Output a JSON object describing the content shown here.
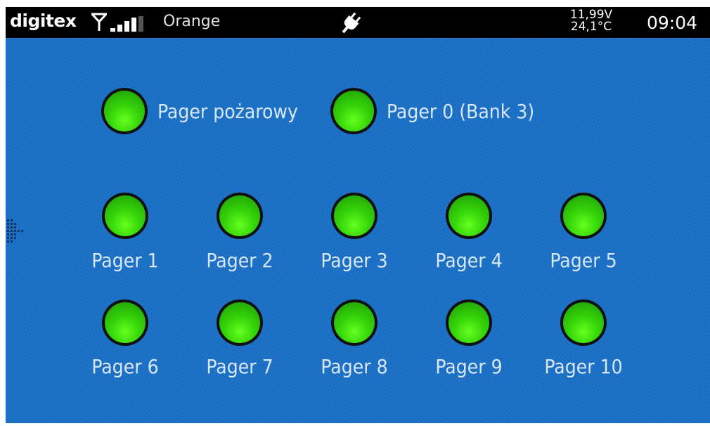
{
  "statusbar": {
    "brand": "digitex",
    "carrier": "Orange",
    "voltage": "11,99V",
    "temperature": "24,1°C",
    "time": "09:04",
    "icons": [
      "antenna-icon",
      "signal-strength-icon",
      "power-plug-icon"
    ]
  },
  "colors": {
    "background": "#1a6fc4",
    "statusbar": "#000000",
    "led_on": "#44e014",
    "label": "#d8e7f7"
  },
  "top_pagers": [
    {
      "label": "Pager pożarowy"
    },
    {
      "label": "Pager 0 (Bank 3)"
    }
  ],
  "pagers_row1": [
    {
      "label": "Pager 1"
    },
    {
      "label": "Pager 2"
    },
    {
      "label": "Pager 3"
    },
    {
      "label": "Pager 4"
    },
    {
      "label": "Pager 5"
    }
  ],
  "pagers_row2": [
    {
      "label": "Pager 6"
    },
    {
      "label": "Pager 7"
    },
    {
      "label": "Pager 8"
    },
    {
      "label": "Pager 9"
    },
    {
      "label": "Pager 10"
    }
  ]
}
